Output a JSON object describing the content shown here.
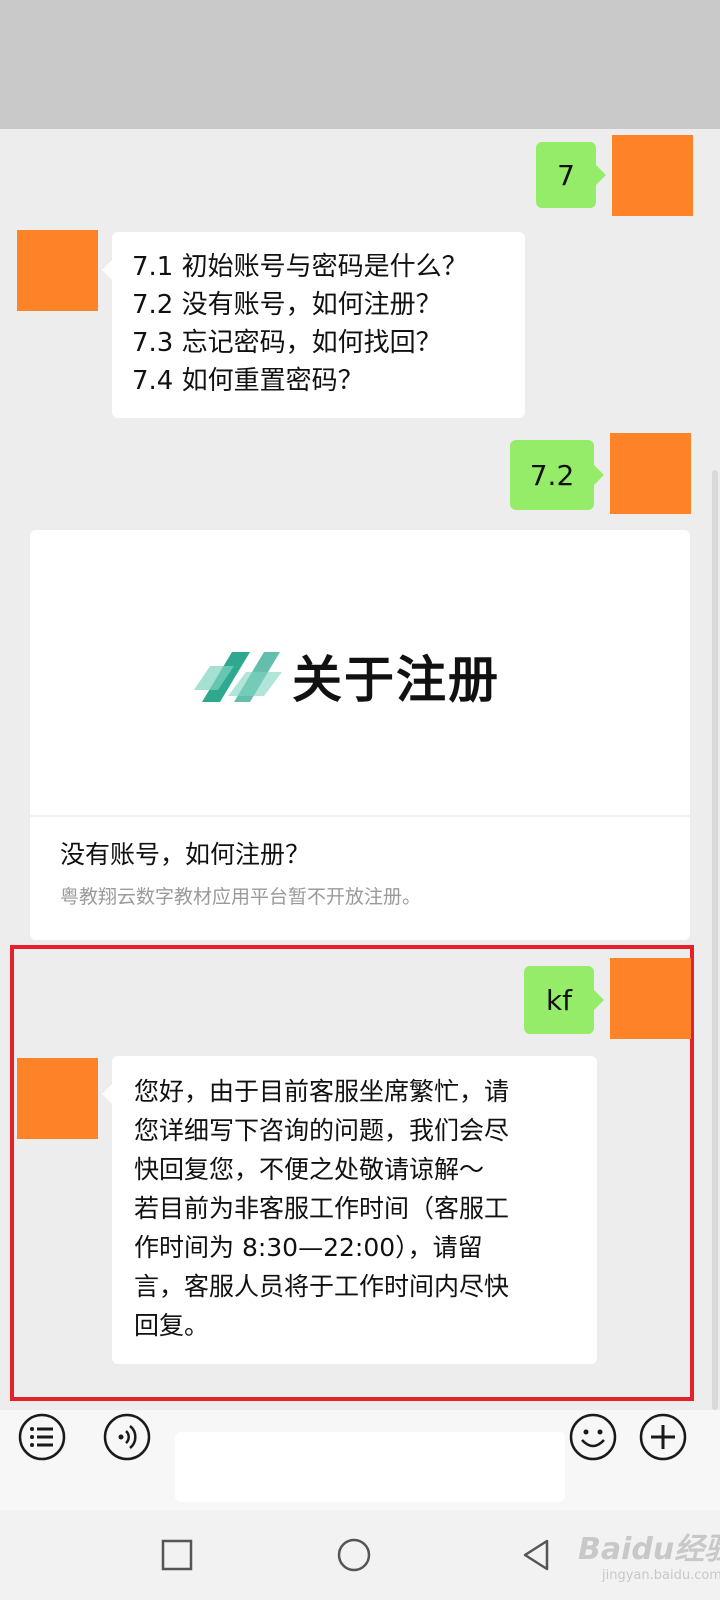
{
  "messages": {
    "m1_text": "7",
    "m2_lines": [
      "7.1 初始账号与密码是什么？",
      "7.2 没有账号，如何注册？",
      "7.3 忘记密码，如何找回？",
      "7.4 如何重置密码？"
    ],
    "m3_text": "7.2",
    "card": {
      "cover_title": "关于注册",
      "title": "没有账号，如何注册？",
      "description": "粤教翔云数字教材应用平台暂不开放注册。"
    },
    "m5_text": "kf",
    "m6_lines": [
      "您好，由于目前客服坐席繁忙，请",
      "您详细写下咨询的问题，我们会尽",
      "快回复您，不便之处敬请谅解～",
      "若目前为非客服工作时间（客服工",
      "作时间为 8:30—22:00），请留",
      "言，客服人员将于工作时间内尽快",
      "回复。"
    ]
  },
  "input_bar": {
    "menu_icon": "list-menu-icon",
    "voice_icon": "voice-icon",
    "emoji_icon": "emoji-icon",
    "plus_icon": "plus-icon",
    "input_value": ""
  },
  "navigation": {
    "recent_icon": "square-recent-icon",
    "home_icon": "circle-home-icon",
    "back_icon": "triangle-back-icon"
  },
  "watermark": {
    "brand": "Baidu经验",
    "sub": "jingyan.baidu.com"
  },
  "colors": {
    "self_bubble": "#95ec69",
    "other_bubble": "#ffffff",
    "avatar": "#fe8228",
    "highlight_border": "#e5212b",
    "chat_background": "#ededed",
    "logo": "#2fa890"
  }
}
